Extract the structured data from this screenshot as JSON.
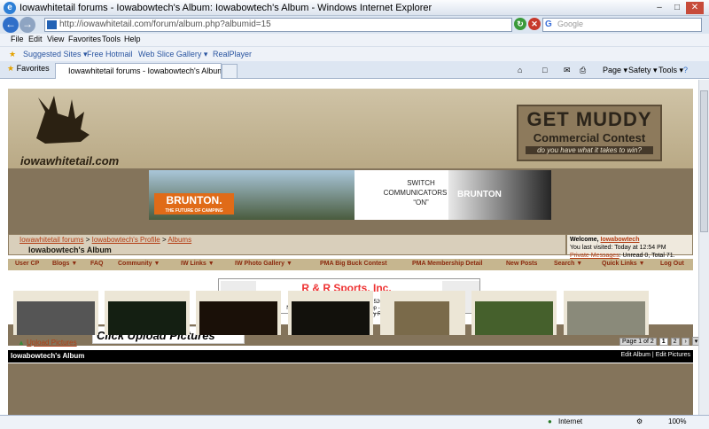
{
  "window": {
    "title": "Iowawhitetail forums - Iowabowtech's Album: Iowabowtech's Album - Windows Internet Explorer"
  },
  "address": {
    "url": "http://iowawhitetail.com/forum/album.php?albumid=15",
    "search_placeholder": "Google"
  },
  "menu": [
    "File",
    "Edit",
    "View",
    "Favorites",
    "Tools",
    "Help"
  ],
  "links_bar": [
    "Suggested Sites ▾",
    "Free Hotmail",
    "Web Slice Gallery ▾",
    "RealPlayer"
  ],
  "tabs": {
    "favorites": "Favorites",
    "active_tab": "Iowawhitetail forums - Iowabowtech's Album: Iowabo...",
    "commands": [
      "Page ▾",
      "Safety ▾",
      "Tools ▾"
    ]
  },
  "site": {
    "logo": "iowawhitetail.com",
    "ad_right": {
      "line1": "GET MUDDY",
      "line2": "Commercial Contest",
      "line3": "do you have what it takes to win?"
    },
    "ad_brunton": {
      "brand": "BRUNTON.",
      "tag": "THE FUTURE OF CAMPING"
    },
    "ad_switch": {
      "text": "SWITCH COMMUNICATORS TO “ON”",
      "brand": "BRUNTON"
    }
  },
  "breadcrumb": {
    "items": [
      "Iowawhitetail forums",
      "Iowabowtech's Profile",
      "Albums"
    ],
    "title": "Iowabowtech's Album"
  },
  "welcome": {
    "label": "Welcome,",
    "user": "Iowabowtech",
    "last_visit": "You last visited: Today at 12:54 PM",
    "pm_link": "Private Messages",
    "pm_text": ": Unread 0, Total 71."
  },
  "nav": [
    "User CP",
    "Blogs ▼",
    "FAQ",
    "Community ▼",
    "IW Links ▼",
    "IW Photo Gallery ▼",
    "PMA Big Buck Contest",
    "PMA Membership Detail",
    "New Posts",
    "Search ▼",
    "Quick Links ▼",
    "Log Out"
  ],
  "ad_rr": {
    "name": "R & R Sports, Inc.",
    "phone": "(563)245-2580",
    "address": "20343 Hwy 13 - Elkader, IA 52043",
    "line2": "New & Used Guns - Archery Pro Shop - Bait - Tackle",
    "line3": "Marine Repair - Indoor Archery Range"
  },
  "upload": {
    "link": "Upload Pictures",
    "callout": "Click Upload Pictures"
  },
  "pager": {
    "label": "Page 1 of 2",
    "pages": [
      "1",
      "2",
      "›",
      "▾"
    ]
  },
  "album": {
    "title": "Iowabowtech's Album",
    "edit_album": "Edit Album",
    "edit_pictures": "Edit Pictures"
  },
  "status": {
    "zone": "Internet",
    "zoom": "100%"
  }
}
